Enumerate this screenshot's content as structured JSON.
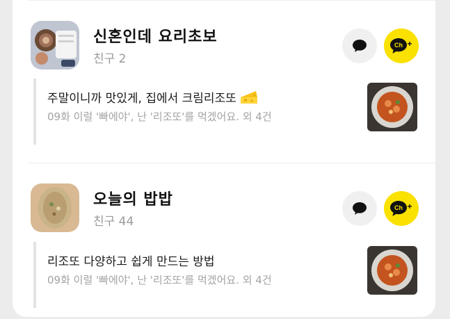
{
  "channels": [
    {
      "name": "신혼인데 요리초보",
      "friends": "친구 2",
      "post": {
        "title": "주말이니까 맛있게, 집에서 크림리조또",
        "subtitle": "09화 이럴 '빠에야', 난 '리조또'를 먹겠어요. 외 4건"
      }
    },
    {
      "name": "오늘의 밥밥",
      "friends": "친구 44",
      "post": {
        "title": "리조또 다양하고 쉽게 만드는 방법",
        "subtitle": "09화 이럴 '빠에야', 난 '리조또'를 먹겠어요. 외 4건"
      }
    }
  ],
  "buttons": {
    "chat_icon": "chat-bubble-icon",
    "channel_icon": "channel-add-icon",
    "channel_label": "Ch",
    "channel_plus": "+"
  },
  "colors": {
    "accent": "#fae100",
    "chat_bg": "#f0f0f0",
    "muted_text": "#9a9a9a"
  }
}
